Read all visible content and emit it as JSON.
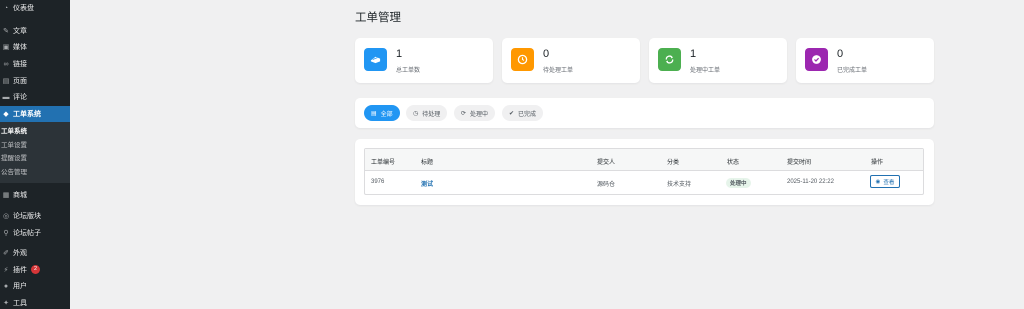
{
  "sidebar": {
    "items_top": [
      {
        "label": "仪表盘",
        "icon": "dashboard-icon"
      },
      {
        "label": "文章",
        "icon": "pin-icon"
      },
      {
        "label": "媒体",
        "icon": "media-icon"
      },
      {
        "label": "链接",
        "icon": "link-icon"
      },
      {
        "label": "页面",
        "icon": "page-icon"
      },
      {
        "label": "评论",
        "icon": "comment-icon"
      }
    ],
    "active": {
      "label": "工单系统",
      "icon": "ticket-icon"
    },
    "submenu": [
      "工单系统",
      "工单设置",
      "提醒设置",
      "公告管理"
    ],
    "items_bottom": [
      {
        "label": "商城",
        "icon": "shop-icon"
      },
      {
        "label": "论坛版块",
        "icon": "forum-section-icon"
      },
      {
        "label": "论坛帖子",
        "icon": "forum-post-icon"
      },
      {
        "label": "外观",
        "icon": "appearance-icon"
      },
      {
        "label": "插件",
        "icon": "plugin-icon",
        "badge": "2"
      },
      {
        "label": "用户",
        "icon": "user-icon"
      },
      {
        "label": "工具",
        "icon": "tools-icon"
      }
    ]
  },
  "page": {
    "title": "工单管理"
  },
  "stats": [
    {
      "value": "1",
      "label": "总工单数",
      "color": "#2196f3",
      "icon": "ticket-icon"
    },
    {
      "value": "0",
      "label": "待处理工单",
      "color": "#ff9800",
      "icon": "clock-icon"
    },
    {
      "value": "1",
      "label": "处理中工单",
      "color": "#4caf50",
      "icon": "sync-icon"
    },
    {
      "value": "0",
      "label": "已完成工单",
      "color": "#9c27b0",
      "icon": "check-circle-icon"
    }
  ],
  "filters": [
    {
      "label": "全部",
      "icon": "list-icon",
      "active": true
    },
    {
      "label": "待处理",
      "icon": "clock-icon"
    },
    {
      "label": "处理中",
      "icon": "sync-icon"
    },
    {
      "label": "已完成",
      "icon": "check-circle-icon"
    }
  ],
  "table": {
    "headers": [
      "工单编号",
      "标题",
      "提交人",
      "分类",
      "状态",
      "提交时间",
      "操作"
    ],
    "rows": [
      {
        "id": "3976",
        "title": "测试",
        "submitter": "源码仓",
        "category": "技术支持",
        "status": "处理中",
        "time": "2025-11-20 22:22",
        "action": "查看"
      }
    ]
  }
}
